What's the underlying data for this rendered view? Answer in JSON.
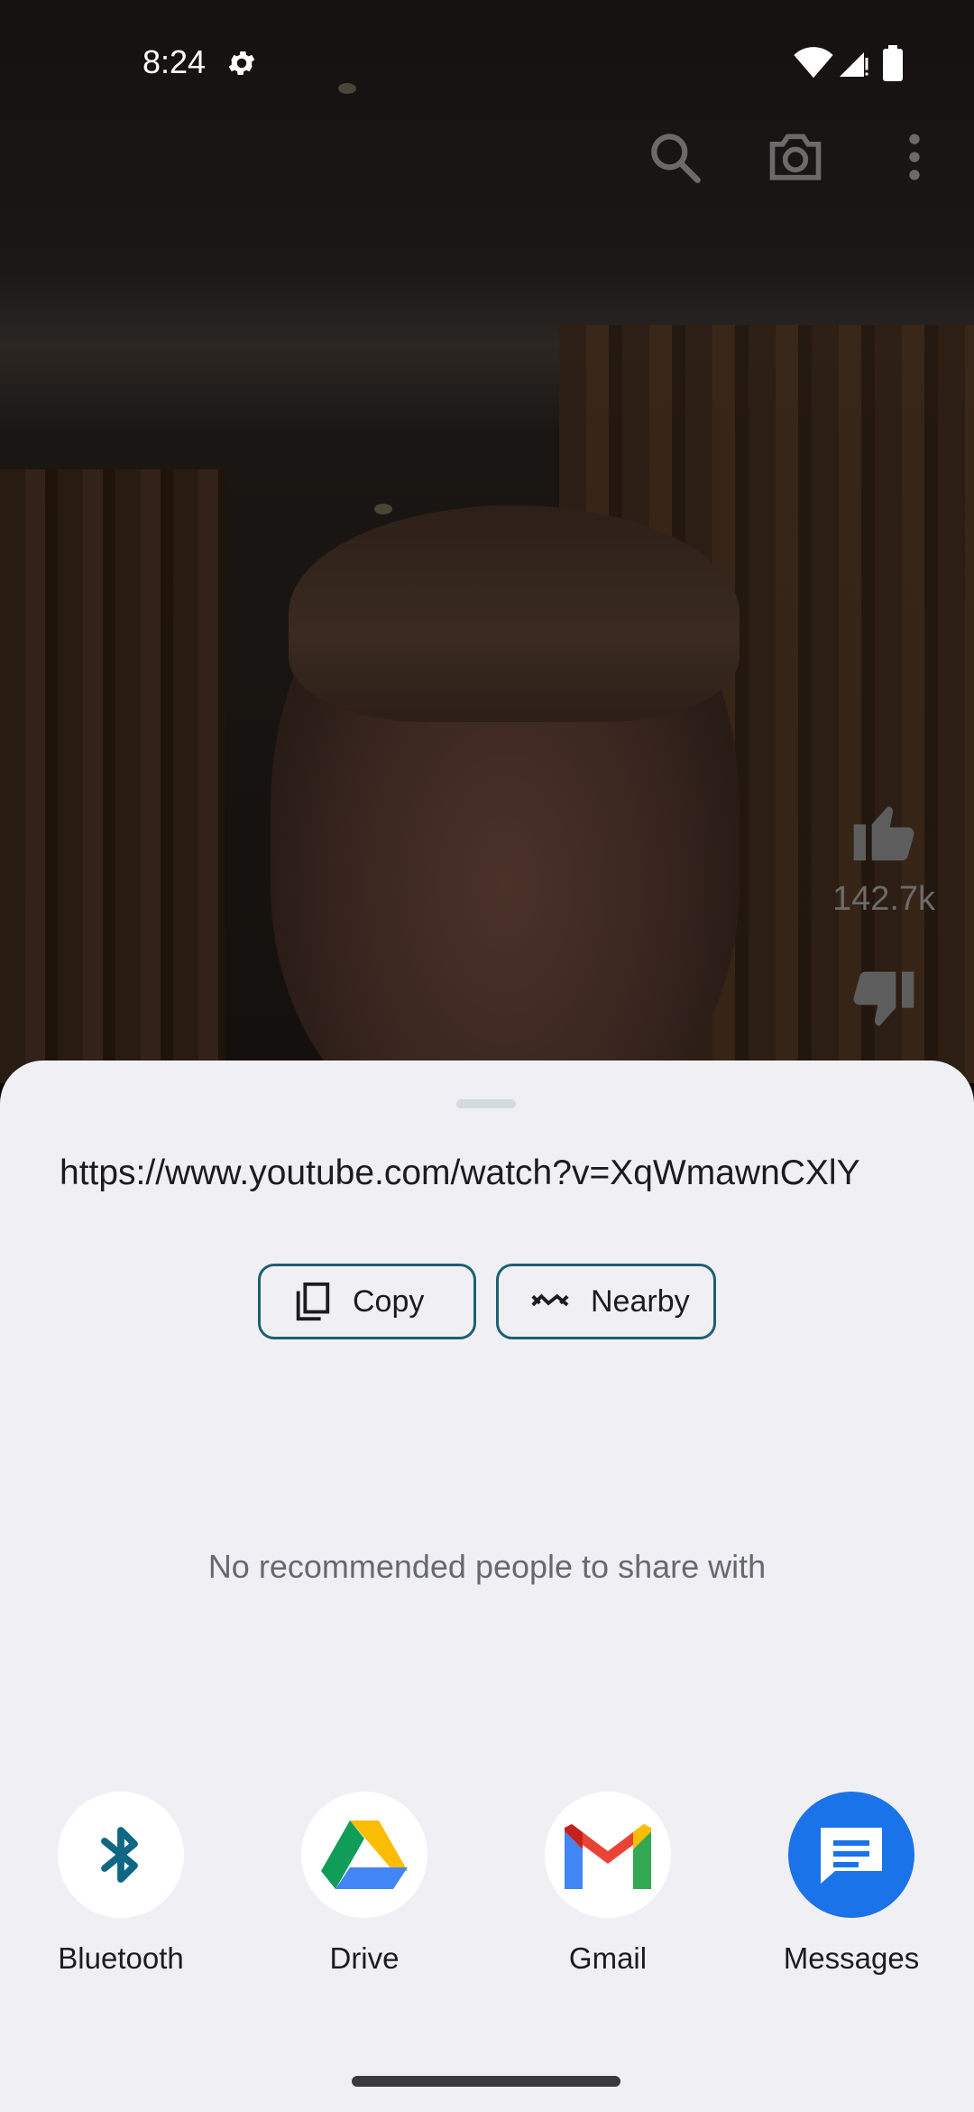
{
  "status_bar": {
    "time": "8:24"
  },
  "video_overlay": {
    "like_count": "142.7k",
    "icons": [
      "search-icon",
      "camera-icon",
      "more-vert-icon",
      "thumb-up-icon",
      "thumb-down-icon"
    ]
  },
  "share_sheet": {
    "url": "https://www.youtube.com/watch?v=XqWmawnCXlY",
    "copy_label": "Copy",
    "nearby_label": "Nearby",
    "empty_people_text": "No recommended people to share with",
    "targets": [
      {
        "label": "Bluetooth",
        "icon": "bluetooth-icon"
      },
      {
        "label": "Drive",
        "icon": "drive-icon"
      },
      {
        "label": "Gmail",
        "icon": "gmail-icon"
      },
      {
        "label": "Messages",
        "icon": "messages-icon"
      }
    ]
  },
  "colors": {
    "sheet_bg": "#f0f0f4",
    "chip_border": "#1d5f73",
    "bluetooth": "#0f6784",
    "messages": "#1a73e8"
  }
}
